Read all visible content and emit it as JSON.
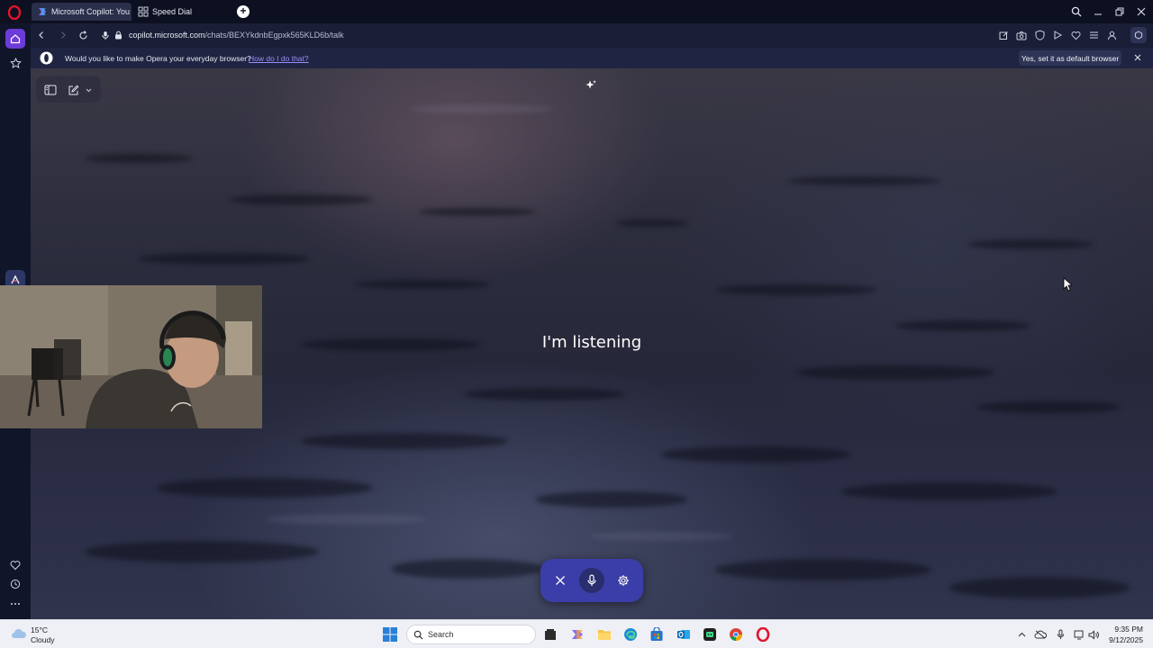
{
  "browser": {
    "tabs": [
      {
        "label": "Microsoft Copilot: You",
        "active": true
      },
      {
        "label": "Speed Dial",
        "active": false
      }
    ],
    "url_host": "copilot.microsoft.com",
    "url_path": "/chats/BEXYkdnbEgpxk565KLD6b/talk"
  },
  "banner": {
    "message": "Would you like to make Opera your everyday browser?",
    "link": "How do I do that?",
    "button": "Yes, set it as default browser"
  },
  "copilot": {
    "status": "I'm listening",
    "voice_controls": [
      "close-icon",
      "microphone-icon",
      "settings-icon"
    ]
  },
  "taskbar": {
    "weather_temp": "15°C",
    "weather_desc": "Cloudy",
    "search_placeholder": "Search",
    "time": "9:35 PM",
    "date": "9/12/2025"
  },
  "colors": {
    "accent": "#6c3bd9",
    "voice_bar": "#3b3ea8",
    "opera_red": "#e0142c",
    "link": "#9b8cf7"
  }
}
